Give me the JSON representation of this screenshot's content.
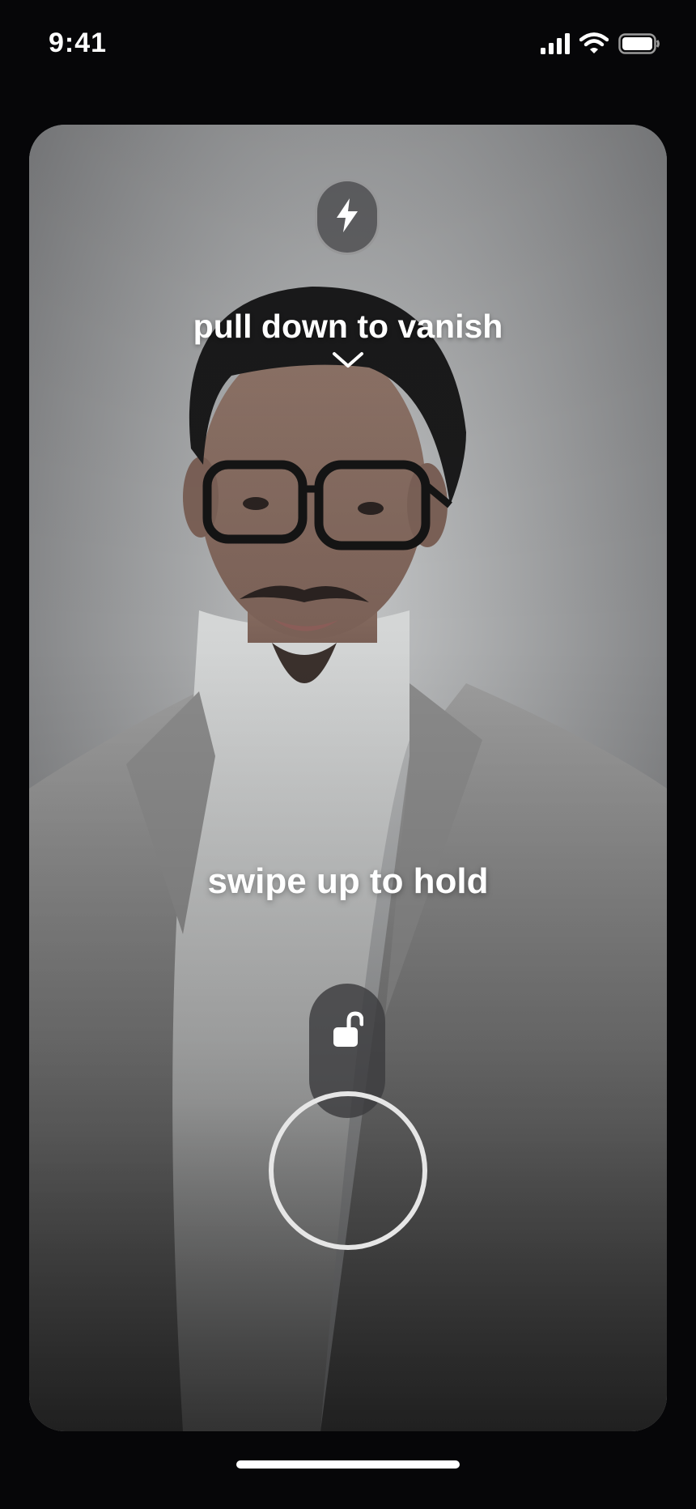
{
  "status_bar": {
    "time": "9:41",
    "icons": [
      "cellular-signal-icon",
      "wifi-icon",
      "battery-icon"
    ]
  },
  "camera": {
    "flash_icon": "lightning-bolt-icon",
    "top_hint": "pull down to vanish",
    "top_hint_icon": "chevron-down-icon",
    "middle_hint": "swipe up to hold",
    "lock_icon": "unlocked-padlock-icon",
    "shutter_icon": "shutter-ring"
  },
  "colors": {
    "background": "#060608",
    "text": "#ffffff",
    "pill": "#3c3c3e",
    "shutter_ring": "#e6e6e6"
  }
}
